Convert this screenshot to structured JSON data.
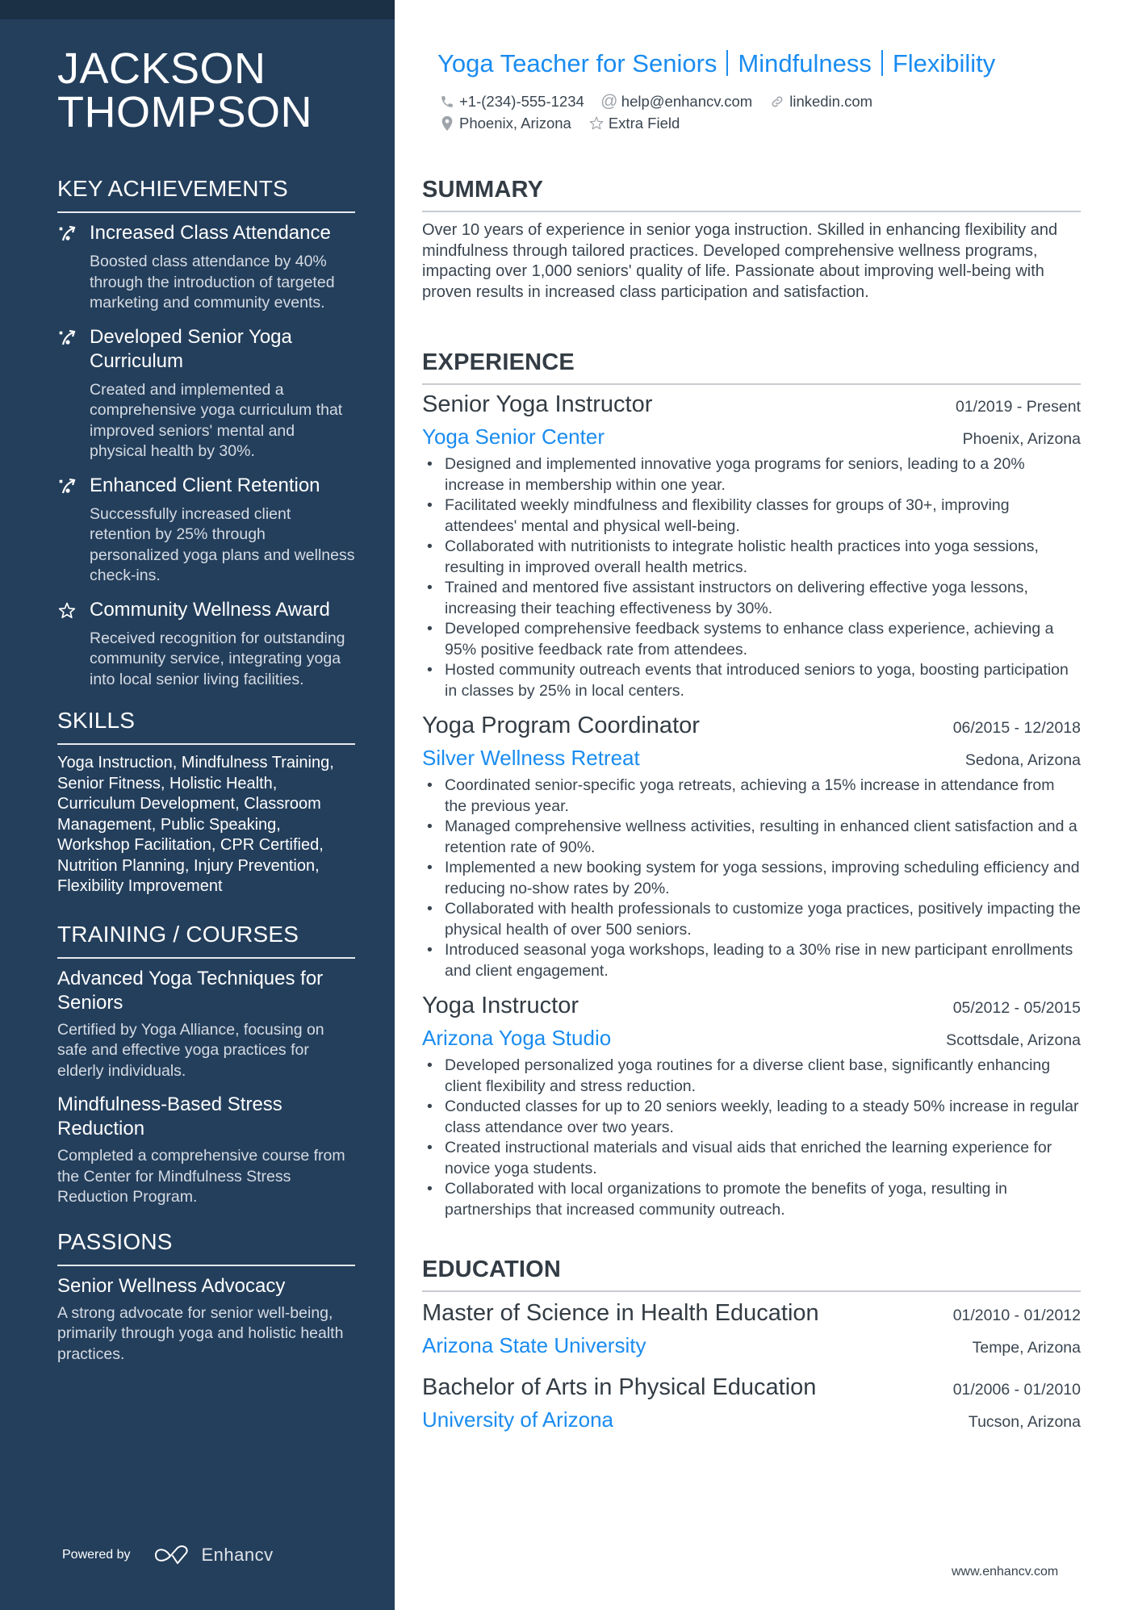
{
  "name": "JACKSON THOMPSON",
  "name_lines": [
    "JACKSON",
    "THOMPSON"
  ],
  "headline": {
    "parts": [
      "Yoga Teacher for Seniors",
      "Mindfulness",
      "Flexibility"
    ]
  },
  "contacts": {
    "phone": {
      "icon": "phone-icon",
      "value": "+1-(234)-555-1234"
    },
    "email": {
      "icon": "at-icon",
      "value": "help@enhancv.com"
    },
    "website": {
      "icon": "link-icon",
      "value": "linkedin.com"
    },
    "location": {
      "icon": "location-pin-icon",
      "value": "Phoenix, Arizona"
    },
    "extra": {
      "icon": "star-icon",
      "value": "Extra Field"
    }
  },
  "sidebar": {
    "key_achievements": {
      "heading": "KEY ACHIEVEMENTS",
      "items": [
        {
          "icon": "growth-arrow-icon",
          "title": "Increased Class Attendance",
          "description": "Boosted class attendance by 40% through the introduction of targeted marketing and community events."
        },
        {
          "icon": "growth-arrow-icon",
          "title": "Developed Senior Yoga Curriculum",
          "description": "Created and implemented a comprehensive yoga curriculum that improved seniors' mental and physical health by 30%."
        },
        {
          "icon": "growth-arrow-icon",
          "title": "Enhanced Client Retention",
          "description": "Successfully increased client retention by 25% through personalized yoga plans and wellness check-ins."
        },
        {
          "icon": "star-icon",
          "title": "Community Wellness Award",
          "description": "Received recognition for outstanding community service, integrating yoga into local senior living facilities."
        }
      ]
    },
    "skills": {
      "heading": "SKILLS",
      "text": "Yoga Instruction, Mindfulness Training, Senior Fitness, Holistic Health, Curriculum Development, Classroom Management, Public Speaking, Workshop Facilitation, CPR Certified, Nutrition Planning, Injury Prevention, Flexibility Improvement"
    },
    "training": {
      "heading": "TRAINING / COURSES",
      "items": [
        {
          "title": "Advanced Yoga Techniques for Seniors",
          "description": "Certified by Yoga Alliance, focusing on safe and effective yoga practices for elderly individuals."
        },
        {
          "title": "Mindfulness-Based Stress Reduction",
          "description": "Completed a comprehensive course from the Center for Mindfulness Stress Reduction Program."
        }
      ]
    },
    "passions": {
      "heading": "PASSIONS",
      "items": [
        {
          "title": "Senior Wellness Advocacy",
          "description": "A strong advocate for senior well-being, primarily through yoga and holistic health practices."
        }
      ]
    },
    "powered_by": {
      "label": "Powered by",
      "brand": "Enhancv"
    }
  },
  "summary": {
    "heading": "SUMMARY",
    "text": "Over 10 years of experience in senior yoga instruction. Skilled in enhancing flexibility and mindfulness through tailored practices. Developed comprehensive wellness programs, impacting over 1,000 seniors' quality of life. Passionate about improving well-being with proven results in increased class participation and satisfaction."
  },
  "experience": {
    "heading": "EXPERIENCE",
    "jobs": [
      {
        "title": "Senior Yoga Instructor",
        "dates": "01/2019 - Present",
        "company": "Yoga Senior Center",
        "location": "Phoenix, Arizona",
        "bullets": [
          "Designed and implemented innovative yoga programs for seniors, leading to a 20% increase in membership within one year.",
          "Facilitated weekly mindfulness and flexibility classes for groups of 30+, improving attendees' mental and physical well-being.",
          "Collaborated with nutritionists to integrate holistic health practices into yoga sessions, resulting in improved overall health metrics.",
          "Trained and mentored five assistant instructors on delivering effective yoga lessons, increasing their teaching effectiveness by 30%.",
          "Developed comprehensive feedback systems to enhance class experience, achieving a 95% positive feedback rate from attendees.",
          "Hosted community outreach events that introduced seniors to yoga, boosting participation in classes by 25% in local centers."
        ]
      },
      {
        "title": "Yoga Program Coordinator",
        "dates": "06/2015 - 12/2018",
        "company": "Silver Wellness Retreat",
        "location": "Sedona, Arizona",
        "bullets": [
          "Coordinated senior-specific yoga retreats, achieving a 15% increase in attendance from the previous year.",
          "Managed comprehensive wellness activities, resulting in enhanced client satisfaction and a retention rate of 90%.",
          "Implemented a new booking system for yoga sessions, improving scheduling efficiency and reducing no-show rates by 20%.",
          "Collaborated with health professionals to customize yoga practices, positively impacting the physical health of over 500 seniors.",
          "Introduced seasonal yoga workshops, leading to a 30% rise in new participant enrollments and client engagement."
        ]
      },
      {
        "title": "Yoga Instructor",
        "dates": "05/2012 - 05/2015",
        "company": "Arizona Yoga Studio",
        "location": "Scottsdale, Arizona",
        "bullets": [
          "Developed personalized yoga routines for a diverse client base, significantly enhancing client flexibility and stress reduction.",
          "Conducted classes for up to 20 seniors weekly, leading to a steady 50% increase in regular class attendance over two years.",
          "Created instructional materials and visual aids that enriched the learning experience for novice yoga students.",
          "Collaborated with local organizations to promote the benefits of yoga, resulting in partnerships that increased community outreach."
        ]
      }
    ]
  },
  "education": {
    "heading": "EDUCATION",
    "items": [
      {
        "degree": "Master of Science in Health Education",
        "dates": "01/2010 - 01/2012",
        "school": "Arizona State University",
        "location": "Tempe, Arizona"
      },
      {
        "degree": "Bachelor of Arts in Physical Education",
        "dates": "01/2006 - 01/2010",
        "school": "University of Arizona",
        "location": "Tucson, Arizona"
      }
    ]
  },
  "footer": {
    "url": "www.enhancv.com"
  },
  "colors": {
    "sidebar_bg": "#243f5c",
    "sidebar_top_strip": "#1b2f45",
    "accent": "#1a8cf0",
    "text_dark": "#333c44",
    "text_body": "#3a4550",
    "rule": "#c7cbcf"
  }
}
